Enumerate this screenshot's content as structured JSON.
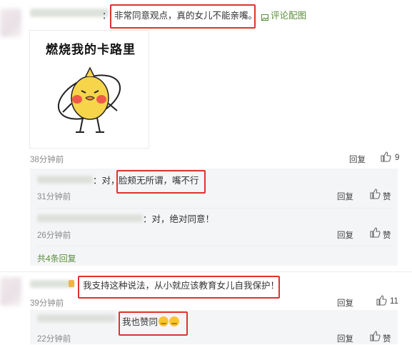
{
  "comments": [
    {
      "text": "非常同意观点，真的女儿不能亲嘴。",
      "prefix": "：",
      "image_action": "评论配图",
      "image_caption": "燃烧我的卡路里",
      "time": "38分钟前",
      "reply_label": "回复",
      "likes": "9"
    },
    {
      "text": "我支持这种说法，从小就应该教育女儿自我保护！",
      "time": "39分钟前",
      "reply_label": "回复",
      "likes": "11"
    },
    {
      "text": "我也赞同",
      "time": "22分钟前",
      "reply_label": "回复",
      "likes": "赞"
    }
  ],
  "replies": [
    {
      "prefix": "：对，",
      "text": "脸颊无所谓，嘴不行",
      "time": "31分钟前",
      "reply_label": "回复",
      "likes": "赞"
    },
    {
      "text": "：对，绝对同意！",
      "time": "26分钟前",
      "reply_label": "回复",
      "likes": "赞"
    }
  ],
  "expand_label": "共4条回复",
  "colors": {
    "highlight": "#e0322f",
    "link_green": "#5b8f3b"
  }
}
